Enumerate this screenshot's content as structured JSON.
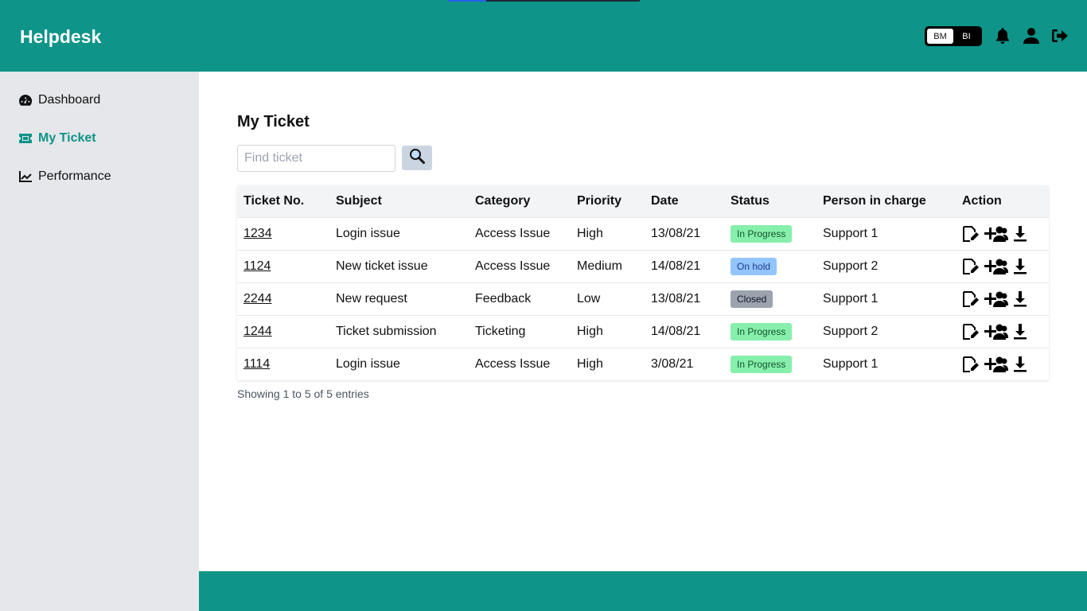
{
  "header": {
    "brand": "Helpdesk",
    "lang_options": [
      "BM",
      "BI"
    ],
    "active_lang": "BM",
    "icons": [
      "bell-icon",
      "user-icon",
      "logout-icon"
    ]
  },
  "sidebar": {
    "items": [
      {
        "label": "Dashboard",
        "icon": "dashboard-icon",
        "active": false
      },
      {
        "label": "My Ticket",
        "icon": "ticket-icon",
        "active": true
      },
      {
        "label": "Performance",
        "icon": "chart-line-icon",
        "active": false
      }
    ]
  },
  "main": {
    "title": "My Ticket",
    "search": {
      "placeholder": "Find ticket",
      "value": ""
    },
    "table": {
      "columns": [
        "Ticket No.",
        "Subject",
        "Category",
        "Priority",
        "Date",
        "Status",
        "Person in charge",
        "Action"
      ],
      "rows": [
        {
          "ticket_no": "1234",
          "subject": "Login issue",
          "category": "Access Issue",
          "priority": "High",
          "date": "13/08/21",
          "status": "In Progress",
          "status_type": "inprogress",
          "person": "Support 1"
        },
        {
          "ticket_no": "1124",
          "subject": "New ticket issue",
          "category": "Access Issue",
          "priority": "Medium",
          "date": "14/08/21",
          "status": "On hold",
          "status_type": "onhold",
          "person": "Support 2"
        },
        {
          "ticket_no": "2244",
          "subject": "New request",
          "category": "Feedback",
          "priority": "Low",
          "date": "13/08/21",
          "status": "Closed",
          "status_type": "closed",
          "person": "Support 1"
        },
        {
          "ticket_no": "1244",
          "subject": "Ticket submission",
          "category": "Ticketing",
          "priority": "High",
          "date": "14/08/21",
          "status": "In Progress",
          "status_type": "inprogress",
          "person": "Support 2"
        },
        {
          "ticket_no": "1114",
          "subject": "Login issue",
          "category": "Access Issue",
          "priority": "High",
          "date": "3/08/21",
          "status": "In Progress",
          "status_type": "inprogress",
          "person": "Support 1"
        }
      ]
    },
    "entries_info": "Showing 1 to 5 of 5 entries"
  },
  "colors": {
    "brand": "#0e9488",
    "sidebar_bg": "#e5e7eb",
    "in_progress": "#86efac",
    "on_hold": "#93c5fd",
    "closed": "#9ca3af"
  }
}
